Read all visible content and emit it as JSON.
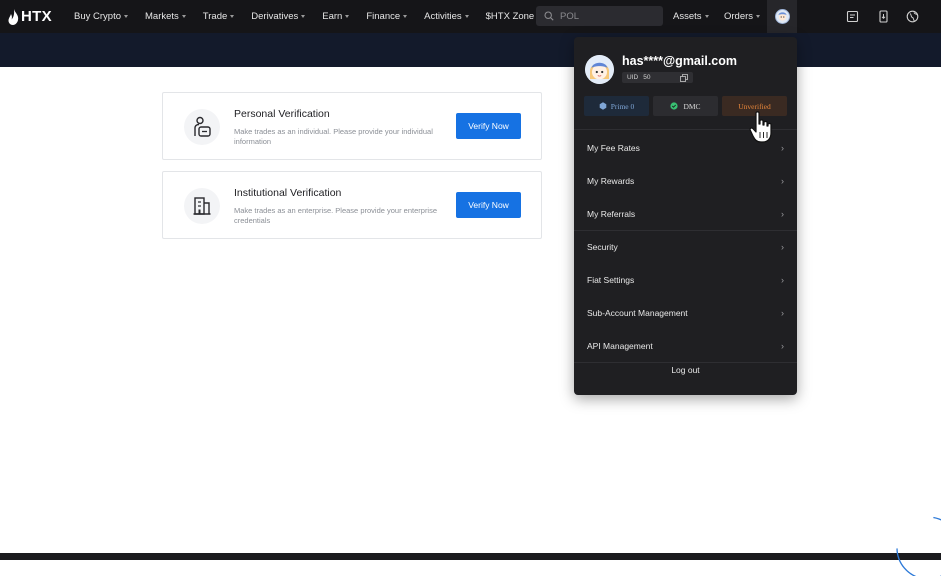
{
  "brand": {
    "logo_text": "HTX"
  },
  "nav": {
    "items": [
      {
        "label": "Buy Crypto"
      },
      {
        "label": "Markets"
      },
      {
        "label": "Trade"
      },
      {
        "label": "Derivatives"
      },
      {
        "label": "Earn"
      },
      {
        "label": "Finance"
      },
      {
        "label": "Activities"
      },
      {
        "label": "$HTX Zone"
      }
    ],
    "search_value": "POL",
    "assets_label": "Assets",
    "orders_label": "Orders"
  },
  "verification": {
    "cards": [
      {
        "title": "Personal Verification",
        "description": "Make trades as an individual. Please provide your individual information",
        "button_label": "Verify Now"
      },
      {
        "title": "Institutional Verification",
        "description": "Make trades as an enterprise. Please provide your enterprise credentials",
        "button_label": "Verify Now"
      }
    ]
  },
  "user_menu": {
    "email": "has****@gmail.com",
    "uid_label": "UID",
    "uid_value": "50",
    "badges": [
      {
        "label": "Prime 0"
      },
      {
        "label": "DMC"
      },
      {
        "label": "Unverified"
      }
    ],
    "items": [
      {
        "label": "My Fee Rates"
      },
      {
        "label": "My Rewards"
      },
      {
        "label": "My Referrals"
      },
      {
        "label": "Security"
      },
      {
        "label": "Fiat Settings"
      },
      {
        "label": "Sub-Account Management"
      },
      {
        "label": "API Management"
      }
    ],
    "logout_label": "Log out"
  },
  "colors": {
    "accent": "#1672e3",
    "unverified": "#e5853a",
    "dmc": "#38c172",
    "prime": "#7fa6d6"
  }
}
